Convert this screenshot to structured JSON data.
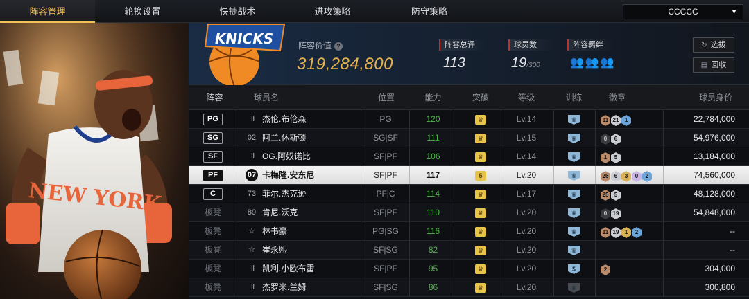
{
  "nav": {
    "tabs": [
      {
        "label": "阵容管理",
        "active": true
      },
      {
        "label": "轮换设置",
        "active": false
      },
      {
        "label": "快捷战术",
        "active": false
      },
      {
        "label": "进攻策略",
        "active": false
      },
      {
        "label": "防守策略",
        "active": false
      }
    ],
    "team_select": "CCCCC"
  },
  "header": {
    "value_label": "阵容价值",
    "value": "319,284,800",
    "stats": [
      {
        "label": "阵容总评",
        "value": "113",
        "suffix": ""
      },
      {
        "label": "球员数",
        "value": "19",
        "suffix": "/300"
      },
      {
        "label": "阵容羁绊",
        "value": "",
        "suffix": ""
      }
    ],
    "buttons": {
      "select": "选拔",
      "recycle": "回收"
    },
    "logo_text": "KNICKS"
  },
  "table": {
    "headers": [
      "阵容",
      "球员名",
      "位置",
      "能力",
      "突破",
      "等级",
      "训练",
      "徽章",
      "球员身价"
    ],
    "rows": [
      {
        "slot": "PG",
        "bench": false,
        "jersey": "ıll",
        "name": "杰伦.布伦森",
        "position": "PG",
        "rating": "120",
        "breakthrough": "",
        "level": "Lv.14",
        "training": "",
        "badges": [
          {
            "t": "11",
            "c": "bronze"
          },
          {
            "t": "21",
            "c": "silver"
          },
          {
            "t": "1",
            "c": "blue"
          }
        ],
        "price": "22,784,000",
        "selected": false
      },
      {
        "slot": "SG",
        "bench": false,
        "jersey": "02",
        "name": "阿兰.休斯顿",
        "position": "SG|SF",
        "rating": "111",
        "breakthrough": "",
        "level": "Lv.15",
        "training": "",
        "badges": [
          {
            "t": "0",
            "c": "dark"
          },
          {
            "t": "6",
            "c": "silver"
          }
        ],
        "price": "54,976,000",
        "selected": false
      },
      {
        "slot": "SF",
        "bench": false,
        "jersey": "ıll",
        "name": "OG.阿奴诺比",
        "position": "SF|PF",
        "rating": "106",
        "breakthrough": "",
        "level": "Lv.14",
        "training": "",
        "badges": [
          {
            "t": "1",
            "c": "bronze"
          },
          {
            "t": "5",
            "c": "silver"
          }
        ],
        "price": "13,184,000",
        "selected": false
      },
      {
        "slot": "PF",
        "bench": false,
        "jersey": "07",
        "name": "卡梅隆.安东尼",
        "position": "SF|PF",
        "rating": "117",
        "breakthrough": "5",
        "level": "Lv.20",
        "training": "",
        "badges": [
          {
            "t": "26",
            "c": "bronze"
          },
          {
            "t": "6",
            "c": "silver"
          },
          {
            "t": "3",
            "c": "gold"
          },
          {
            "t": "0",
            "c": "purple"
          },
          {
            "t": "2",
            "c": "blue"
          }
        ],
        "price": "74,560,000",
        "selected": true
      },
      {
        "slot": "C",
        "bench": false,
        "jersey": "73",
        "name": "菲尔.杰克逊",
        "position": "PF|C",
        "rating": "114",
        "breakthrough": "",
        "level": "Lv.17",
        "training": "",
        "badges": [
          {
            "t": "25",
            "c": "bronze"
          },
          {
            "t": "5",
            "c": "silver"
          }
        ],
        "price": "48,128,000",
        "selected": false
      },
      {
        "slot": "板凳",
        "bench": true,
        "jersey": "89",
        "name": "肯尼.沃克",
        "position": "SF|PF",
        "rating": "110",
        "breakthrough": "",
        "level": "Lv.20",
        "training": "",
        "badges": [
          {
            "t": "0",
            "c": "dark"
          },
          {
            "t": "19",
            "c": "silver"
          }
        ],
        "price": "54,848,000",
        "selected": false
      },
      {
        "slot": "板凳",
        "bench": true,
        "jersey": "☆",
        "name": "林书豪",
        "position": "PG|SG",
        "rating": "116",
        "breakthrough": "",
        "level": "Lv.20",
        "training": "",
        "badges": [
          {
            "t": "11",
            "c": "bronze"
          },
          {
            "t": "19",
            "c": "silver"
          },
          {
            "t": "1",
            "c": "gold"
          },
          {
            "t": "2",
            "c": "blue"
          }
        ],
        "price": "--",
        "selected": false
      },
      {
        "slot": "板凳",
        "bench": true,
        "jersey": "☆",
        "name": "崔永熙",
        "position": "SF|SG",
        "rating": "82",
        "breakthrough": "",
        "level": "Lv.20",
        "training": "",
        "badges": [],
        "price": "--",
        "selected": false
      },
      {
        "slot": "板凳",
        "bench": true,
        "jersey": "ıll",
        "name": "凯利.小欧布雷",
        "position": "SF|PF",
        "rating": "95",
        "breakthrough": "",
        "level": "Lv.20",
        "training": "5",
        "badges": [
          {
            "t": "2",
            "c": "bronze"
          }
        ],
        "price": "304,000",
        "selected": false
      },
      {
        "slot": "板凳",
        "bench": true,
        "jersey": "ıll",
        "name": "杰罗米.兰姆",
        "position": "SF|SG",
        "rating": "86",
        "breakthrough": "",
        "level": "Lv.20",
        "training": "grey",
        "badges": [],
        "price": "300,800",
        "selected": false
      }
    ]
  },
  "colors": {
    "accent": "#f2c15a",
    "value": "#e6b24f",
    "rating": "#4fb848",
    "stat_marker": "#c0302a"
  }
}
